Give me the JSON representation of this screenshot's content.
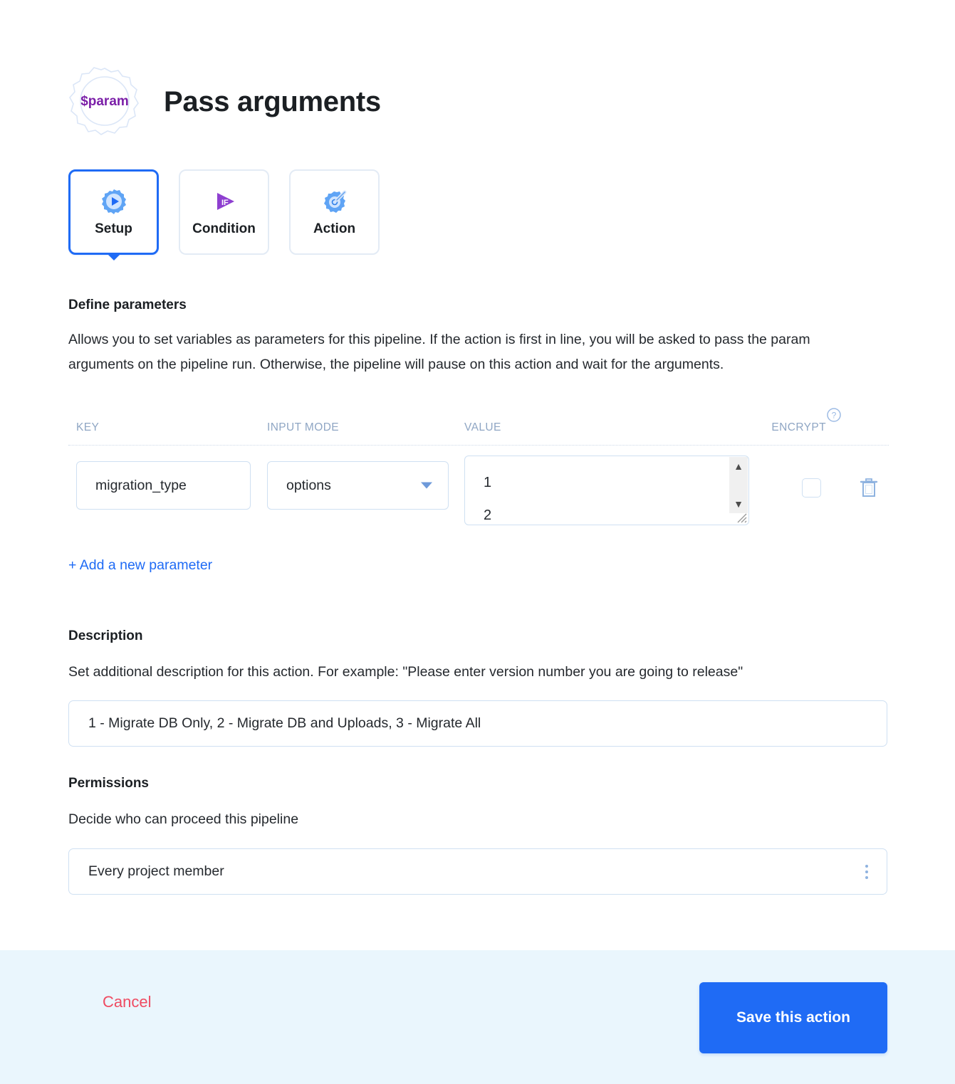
{
  "header": {
    "title": "Pass arguments",
    "logo_text": "$param",
    "logo_icon": "gear-outline-icon"
  },
  "tabs": [
    {
      "label": "Setup",
      "icon": "gear-play-icon",
      "active": true
    },
    {
      "label": "Condition",
      "icon": "if-play-icon",
      "active": false
    },
    {
      "label": "Action",
      "icon": "gear-wand-icon",
      "active": false
    }
  ],
  "define_parameters": {
    "heading": "Define parameters",
    "description": "Allows you to set variables as parameters for this pipeline. If the action is first in line, you will be asked to pass the param arguments on the pipeline run. Otherwise, the pipeline will pause on this action and wait for the arguments.",
    "columns": {
      "key": "KEY",
      "input_mode": "INPUT MODE",
      "value": "VALUE",
      "encrypt": "ENCRYPT",
      "encrypt_help_icon": "question-circle-icon"
    },
    "rows": [
      {
        "key": "migration_type",
        "input_mode": "options",
        "value_line_1": "1",
        "value_line_2": "2",
        "encrypt_checked": false,
        "delete_icon": "trash-icon"
      }
    ],
    "add_link": "+ Add a new parameter"
  },
  "description_section": {
    "heading": "Description",
    "help_text": "Set additional description for this action. For example: \"Please enter version number you are going to release\"",
    "value": "1 - Migrate DB Only, 2 - Migrate DB and Uploads, 3 - Migrate All"
  },
  "permissions_section": {
    "heading": "Permissions",
    "help_text": "Decide who can proceed this pipeline",
    "value": "Every project member",
    "menu_icon": "kebab-menu-icon"
  },
  "footer": {
    "cancel_label": "Cancel",
    "save_label": "Save this action"
  },
  "colors": {
    "accent_blue": "#1f6bf5",
    "cancel_red": "#ef4b62",
    "footer_bg": "#eaf6fd",
    "field_border": "#cfe0f2",
    "column_header": "#8fa6c4",
    "logo_purple": "#7b1fa8"
  }
}
